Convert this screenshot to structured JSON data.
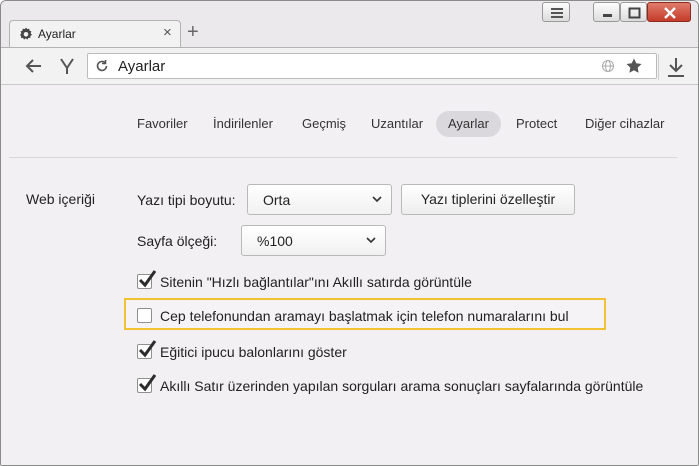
{
  "tab": {
    "title": "Ayarlar",
    "close": "×",
    "icon": "gear-icon"
  },
  "new_tab": {
    "label": "+"
  },
  "address_bar": {
    "text": "Ayarlar"
  },
  "nav": {
    "items": [
      {
        "label": "Favoriler",
        "active": false
      },
      {
        "label": "İndirilenler",
        "active": false
      },
      {
        "label": "Geçmiş",
        "active": false
      },
      {
        "label": "Uzantılar",
        "active": false
      },
      {
        "label": "Ayarlar",
        "active": true
      },
      {
        "label": "Protect",
        "active": false
      },
      {
        "label": "Diğer cihazlar",
        "active": false
      }
    ]
  },
  "section": {
    "title": "Web içeriği",
    "font_size_label": "Yazı tipi boyutu:",
    "font_size_value": "Orta",
    "customize_fonts_button": "Yazı tiplerini özelleştir",
    "page_zoom_label": "Sayfa ölçeği:",
    "page_zoom_value": "%100"
  },
  "checkboxes": [
    {
      "label": "Sitenin \"Hızlı bağlantılar\"ını Akıllı satırda görüntüle",
      "checked": true
    },
    {
      "label": "Cep telefonundan aramayı başlatmak için telefon numaralarını bul",
      "checked": false,
      "highlighted": true
    },
    {
      "label": "Eğitici ipucu balonlarını göster",
      "checked": true
    },
    {
      "label": "Akıllı Satır üzerinden yapılan sorguları arama sonuçları sayfalarında görüntüle",
      "checked": true
    }
  ],
  "colors": {
    "highlight": "#f1c232",
    "background": "#f2f0f3"
  }
}
